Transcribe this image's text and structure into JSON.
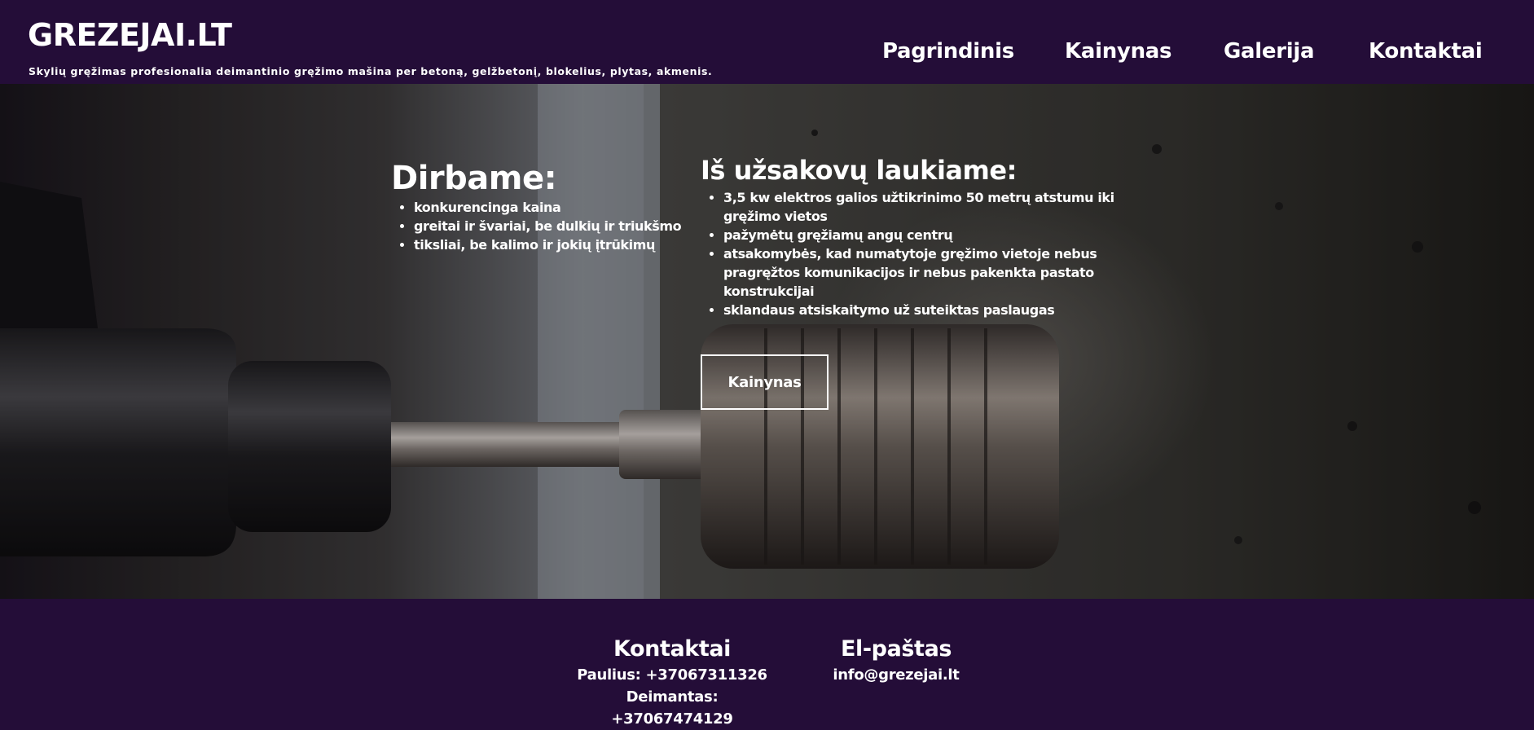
{
  "header": {
    "logo": "GREZEJAI.LT",
    "tagline": "Skylių gręžimas profesionalia deimantinio gręžimo mašina per betoną, gelžbetonį, blokelius, plytas, akmenis.",
    "nav": [
      {
        "label": "Pagrindinis"
      },
      {
        "label": "Kainynas"
      },
      {
        "label": "Galerija"
      },
      {
        "label": "Kontaktai"
      }
    ]
  },
  "hero": {
    "left": {
      "heading": "Dirbame:",
      "items": [
        "konkurencinga kaina",
        "greitai ir švariai, be dulkių ir triukšmo",
        "tiksliai, be kalimo ir jokių įtrūkimų"
      ]
    },
    "right": {
      "heading": "Iš užsakovų laukiame:",
      "items": [
        "3,5 kw elektros galios užtikrinimo 50 metrų atstumu iki gręžimo vietos",
        "pažymėtų gręžiamų angų centrų",
        "atsakomybės, kad numatytoje gręžimo vietoje nebus pragręžtos komunikacijos ir nebus pakenkta pastato konstrukcijai",
        "sklandaus atsiskaitymo už suteiktas paslaugas"
      ]
    },
    "button_label": "Kainynas",
    "background_icon": "core-drill-photo"
  },
  "footer": {
    "contacts": {
      "heading": "Kontaktai",
      "lines": [
        "Paulius: +37067311326",
        "Deimantas: +37067474129"
      ]
    },
    "email": {
      "heading": "El-paštas",
      "address": "info@grezejai.lt"
    }
  },
  "colors": {
    "brand_purple": "#240d38",
    "text": "#ffffff"
  }
}
